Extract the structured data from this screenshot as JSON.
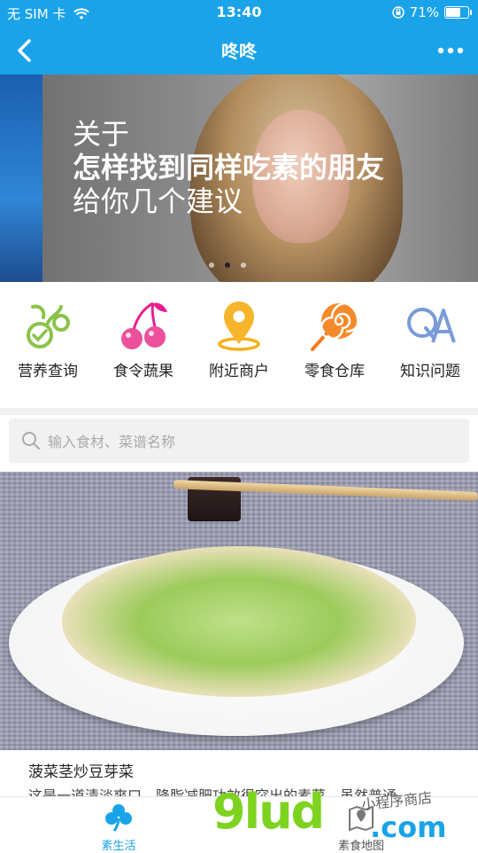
{
  "status_bar": {
    "carrier": "无 SIM 卡",
    "time": "13:40",
    "battery": "71%",
    "battery_level": 0.71
  },
  "nav": {
    "title": "咚咚"
  },
  "banner": {
    "line1": "关于",
    "line2": "怎样找到同样吃素的朋友",
    "line3": "给你几个建议",
    "page_count": 3,
    "active_page": 2
  },
  "categories": [
    {
      "label": "营养查询",
      "icon": "nutrition-icon"
    },
    {
      "label": "食令蔬果",
      "icon": "cherry-icon"
    },
    {
      "label": "附近商户",
      "icon": "location-pin-icon"
    },
    {
      "label": "零食仓库",
      "icon": "lollipop-icon"
    },
    {
      "label": "知识问题",
      "icon": "qa-icon"
    }
  ],
  "search": {
    "placeholder": "输入食材、菜谱名称"
  },
  "recipe": {
    "title": "菠菜茎炒豆芽菜",
    "description": "这是一道清淡爽口，降脂减肥功效很突出的素菜。虽然普通"
  },
  "tabbar": {
    "tab1_label": "素生活",
    "tab2_label": "素食地图"
  },
  "watermark": {
    "brand": "9lud",
    "suffix": ".com",
    "tagline": "小程序商店"
  },
  "colors": {
    "primary": "#1aa3e8",
    "watermark_green": "#7ed321"
  }
}
